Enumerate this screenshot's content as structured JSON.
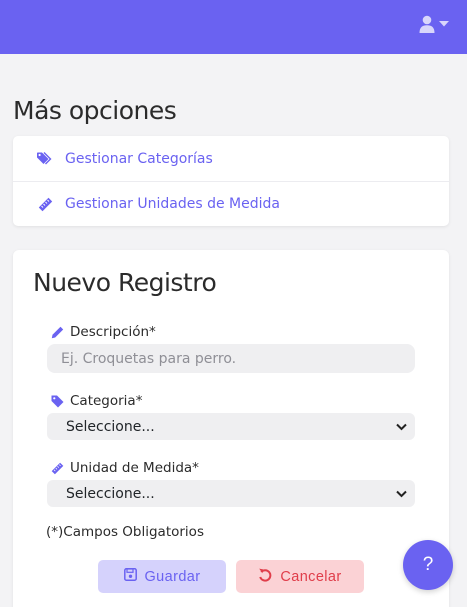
{
  "colors": {
    "accent": "#6a62f1",
    "danger": "#e03d4a",
    "page_bg": "#f3f3f5"
  },
  "header": {
    "user_icon": "user-icon",
    "caret_icon": "caret-down-icon"
  },
  "more_options": {
    "title": "Más opciones",
    "items": [
      {
        "label": "Gestionar Categorías",
        "icon": "tags-icon"
      },
      {
        "label": "Gestionar Unidades de Medida",
        "icon": "ruler-icon"
      }
    ]
  },
  "form": {
    "title": "Nuevo Registro",
    "description": {
      "label": "Descripción*",
      "placeholder": "Ej. Croquetas para perro.",
      "value": "",
      "icon": "pencil-icon"
    },
    "category": {
      "label": "Categoria*",
      "selected": "Seleccione...",
      "icon": "tag-icon"
    },
    "unit": {
      "label": "Unidad de Medida*",
      "selected": "Seleccione...",
      "icon": "ruler-icon"
    },
    "required_note": "(*)Campos Obligatorios",
    "save_label": "Guardar",
    "cancel_label": "Cancelar"
  },
  "help": {
    "label": "?"
  }
}
